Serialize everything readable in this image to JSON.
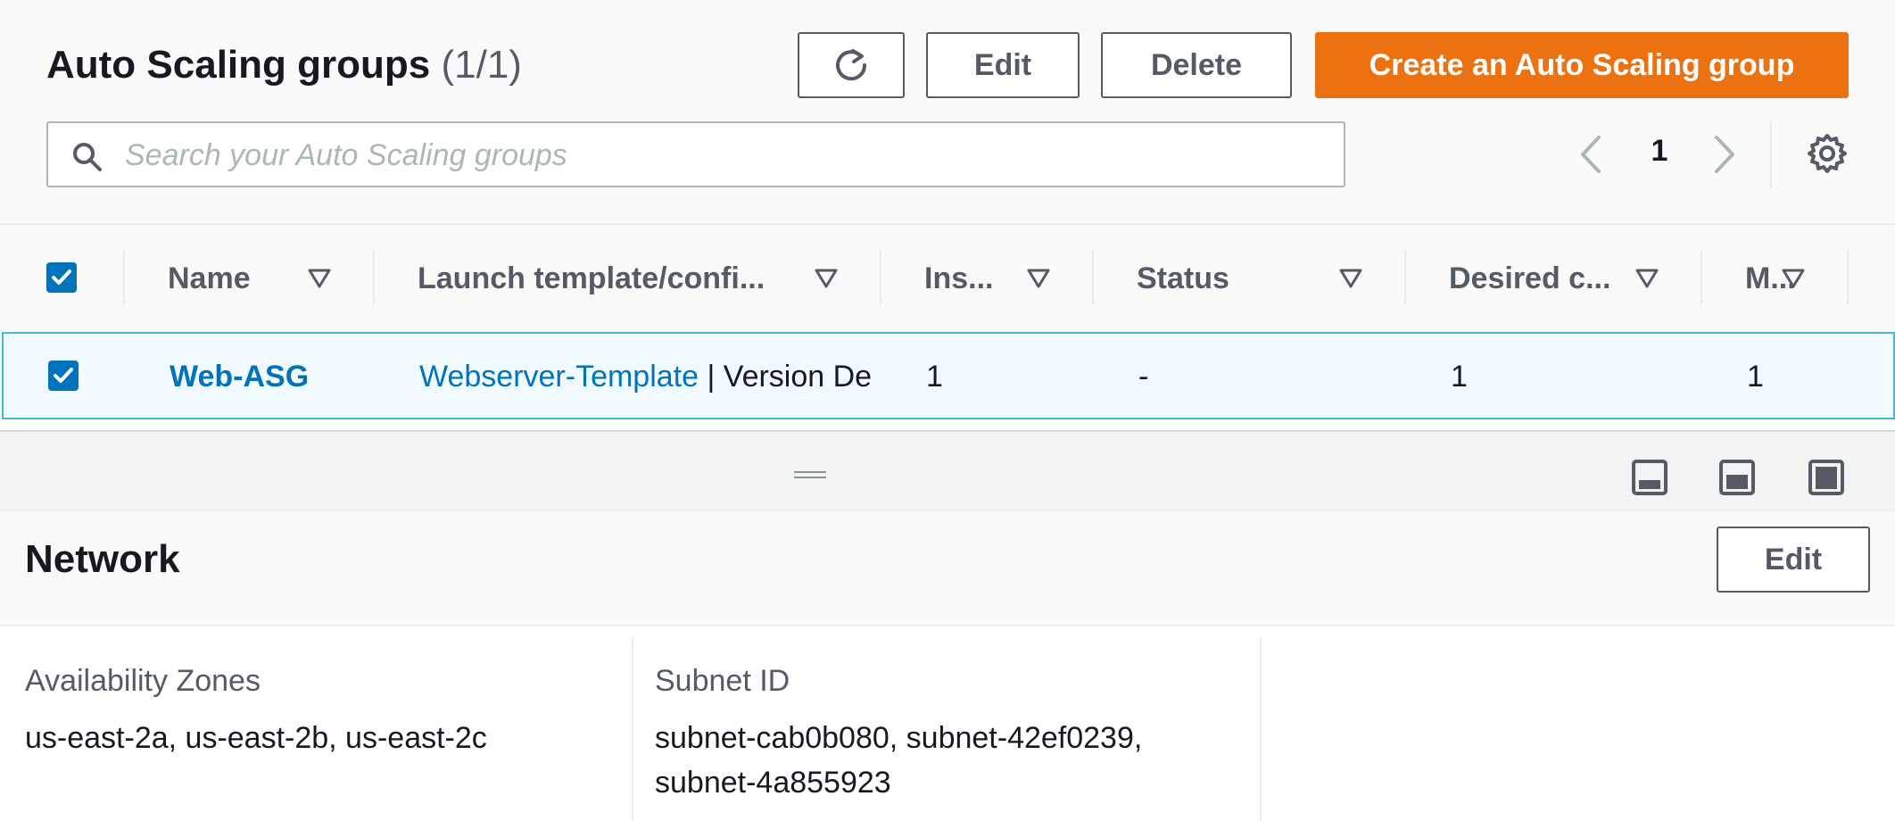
{
  "header": {
    "title": "Auto Scaling groups",
    "count": "(1/1)",
    "edit_label": "Edit",
    "delete_label": "Delete",
    "create_label": "Create an Auto Scaling group"
  },
  "search": {
    "placeholder": "Search your Auto Scaling groups",
    "value": ""
  },
  "pagination": {
    "current_page": "1"
  },
  "table": {
    "columns": [
      "Name",
      "Launch template/confi...",
      "Ins...",
      "Status",
      "Desired c...",
      "M..."
    ],
    "rows": [
      {
        "selected": true,
        "name": "Web-ASG",
        "launch_template_link": "Webserver-Template",
        "launch_template_suffix": " | Version De",
        "instances": "1",
        "status": "-",
        "desired_capacity": "1",
        "min": "1"
      }
    ]
  },
  "details": {
    "title": "Network",
    "edit_label": "Edit",
    "fields": [
      {
        "label": "Availability Zones",
        "value": "us-east-2a, us-east-2b, us-east-2c"
      },
      {
        "label": "Subnet ID",
        "value_line1": "subnet-cab0b080, subnet-42ef0239,",
        "value_line2": "subnet-4a855923"
      }
    ]
  },
  "colors": {
    "primary": "#ec7211",
    "link": "#0073bb",
    "selected_row_bg": "#f1faff",
    "selected_row_border": "#44b9d6"
  },
  "icons": [
    "refresh-icon",
    "search-icon",
    "chevron-left-icon",
    "chevron-right-icon",
    "gear-icon",
    "sort-icon",
    "checkbox-checked-icon",
    "drag-handle-icon",
    "split-bottom-icon",
    "split-side-icon",
    "split-full-icon"
  ]
}
